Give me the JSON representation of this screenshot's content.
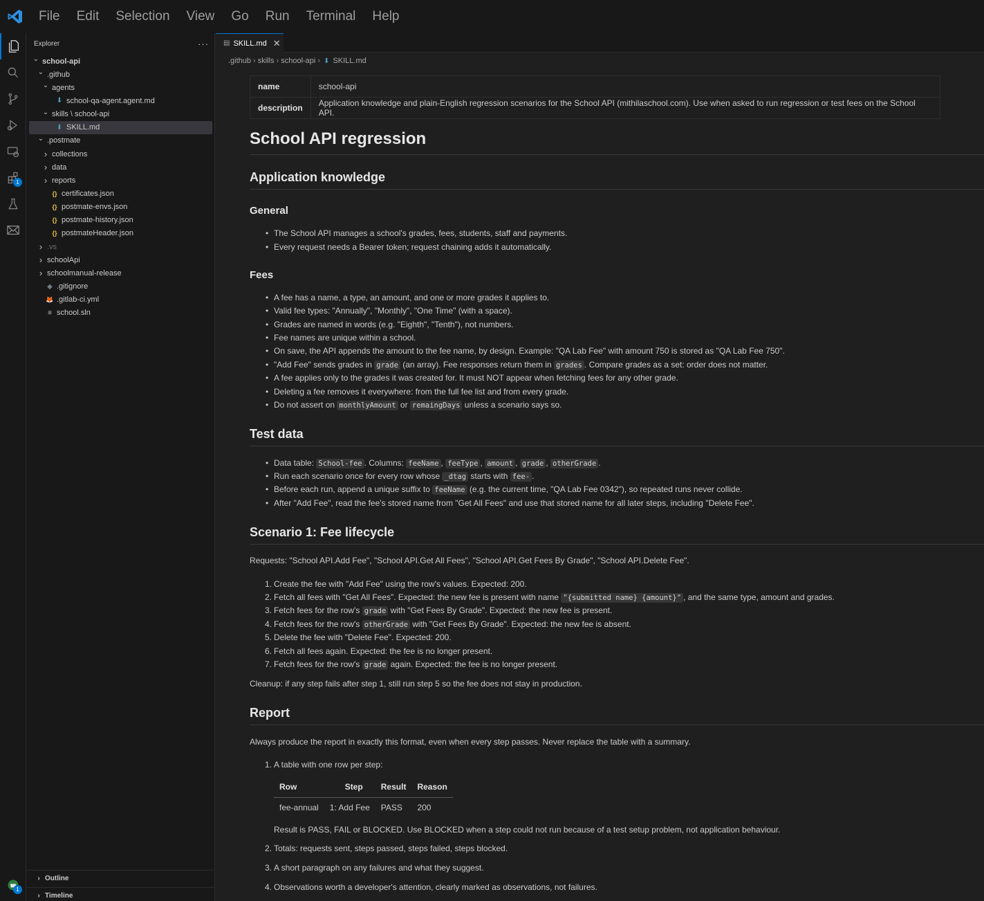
{
  "menu": [
    "File",
    "Edit",
    "Selection",
    "View",
    "Go",
    "Run",
    "Terminal",
    "Help"
  ],
  "activity": {
    "extensions_badge": "1",
    "accounts_badge": "1"
  },
  "explorer": {
    "title": "Explorer",
    "more": "···",
    "tree": [
      {
        "label": "school-api",
        "depth": 0,
        "chev": "open",
        "icon": "",
        "bold": true
      },
      {
        "label": ".github",
        "depth": 1,
        "chev": "open",
        "icon": ""
      },
      {
        "label": "agents",
        "depth": 2,
        "chev": "open",
        "icon": ""
      },
      {
        "label": "school-qa-agent.agent.md",
        "depth": 3,
        "chev": "",
        "icon": "md"
      },
      {
        "label": "skills \\ school-api",
        "depth": 2,
        "chev": "open",
        "icon": ""
      },
      {
        "label": "SKILL.md",
        "depth": 3,
        "chev": "",
        "icon": "md",
        "selected": true
      },
      {
        "label": ".postmate",
        "depth": 1,
        "chev": "open",
        "icon": ""
      },
      {
        "label": "collections",
        "depth": 2,
        "chev": "closed",
        "icon": ""
      },
      {
        "label": "data",
        "depth": 2,
        "chev": "closed",
        "icon": ""
      },
      {
        "label": "reports",
        "depth": 2,
        "chev": "closed",
        "icon": ""
      },
      {
        "label": "certificates.json",
        "depth": 2,
        "chev": "",
        "icon": "json"
      },
      {
        "label": "postmate-envs.json",
        "depth": 2,
        "chev": "",
        "icon": "json"
      },
      {
        "label": "postmate-history.json",
        "depth": 2,
        "chev": "",
        "icon": "json"
      },
      {
        "label": "postmateHeader.json",
        "depth": 2,
        "chev": "",
        "icon": "json"
      },
      {
        "label": ".vs",
        "depth": 1,
        "chev": "closed",
        "icon": "",
        "dim": true
      },
      {
        "label": "schoolApi",
        "depth": 1,
        "chev": "closed",
        "icon": ""
      },
      {
        "label": "schoolmanual-release",
        "depth": 1,
        "chev": "closed",
        "icon": ""
      },
      {
        "label": ".gitignore",
        "depth": 1,
        "chev": "",
        "icon": "git"
      },
      {
        "label": ".gitlab-ci.yml",
        "depth": 1,
        "chev": "",
        "icon": "gitlab"
      },
      {
        "label": "school.sln",
        "depth": 1,
        "chev": "",
        "icon": "sln"
      }
    ],
    "outline": "Outline",
    "timeline": "Timeline"
  },
  "tab": {
    "label": "SKILL.md",
    "close": "✕"
  },
  "breadcrumb": [
    ".github",
    "skills",
    "school-api",
    "SKILL.md"
  ],
  "frontmatter": {
    "name_key": "name",
    "name_val": "school-api",
    "desc_key": "description",
    "desc_val": "Application knowledge and plain-English regression scenarios for the School API (mithilaschool.com). Use when asked to run regression or test fees on the School API."
  },
  "doc": {
    "h1": "School API regression",
    "h2_app": "Application knowledge",
    "h3_general": "General",
    "general": [
      "The School API manages a school's grades, fees, students, staff and payments.",
      "Every request needs a Bearer token; request chaining adds it automatically."
    ],
    "h3_fees": "Fees",
    "fees": {
      "f1": "A fee has a name, a type, an amount, and one or more grades it applies to.",
      "f2": "Valid fee types: \"Annually\", \"Monthly\", \"One Time\" (with a space).",
      "f3": "Grades are named in words (e.g. \"Eighth\", \"Tenth\"), not numbers.",
      "f4": "Fee names are unique within a school.",
      "f5": "On save, the API appends the amount to the fee name, by design. Example: \"QA Lab Fee\" with amount 750 is stored as \"QA Lab Fee 750\".",
      "f6a": "\"Add Fee\" sends grades in ",
      "f6c1": "grade",
      "f6b": " (an array). Fee responses return them in ",
      "f6c2": "grades",
      "f6d": ". Compare grades as a set: order does not matter.",
      "f7": "A fee applies only to the grades it was created for. It must NOT appear when fetching fees for any other grade.",
      "f8": "Deleting a fee removes it everywhere: from the full fee list and from every grade.",
      "f9a": "Do not assert on ",
      "f9c1": "monthlyAmount",
      "f9b": " or ",
      "f9c2": "remaingDays",
      "f9d": " unless a scenario says so."
    },
    "h2_test": "Test data",
    "test": {
      "t1a": "Data table: ",
      "t1c1": "School-fee",
      "t1b": ". Columns: ",
      "t1c2": "feeName",
      "t1c3": "feeType",
      "t1c4": "amount",
      "t1c5": "grade",
      "t1c6": "otherGrade",
      "comma": ", ",
      "period": ".",
      "t2a": "Run each scenario once for every row whose ",
      "t2c1": "_dtag",
      "t2b": " starts with ",
      "t2c2": "fee-",
      "t3a": "Before each run, append a unique suffix to ",
      "t3c": "feeName",
      "t3b": " (e.g. the current time, \"QA Lab Fee 0342\"), so repeated runs never collide.",
      "t4": "After \"Add Fee\", read the fee's stored name from \"Get All Fees\" and use that stored name for all later steps, including \"Delete Fee\"."
    },
    "h2_scn": "Scenario 1: Fee lifecycle",
    "scn_requests": "Requests: \"School API.Add Fee\", \"School API.Get All Fees\", \"School API.Get Fees By Grade\", \"School API.Delete Fee\".",
    "steps": {
      "s1": "Create the fee with \"Add Fee\" using the row's values. Expected: 200.",
      "s2a": "Fetch all fees with \"Get All Fees\". Expected: the new fee is present with name ",
      "s2c": "\"{submitted name} {amount}\"",
      "s2b": ", and the same type, amount and grades.",
      "s3a": "Fetch fees for the row's ",
      "s3c": "grade",
      "s3b": " with \"Get Fees By Grade\". Expected: the new fee is present.",
      "s4a": "Fetch fees for the row's ",
      "s4c": "otherGrade",
      "s4b": " with \"Get Fees By Grade\". Expected: the new fee is absent.",
      "s5": "Delete the fee with \"Delete Fee\". Expected: 200.",
      "s6": "Fetch all fees again. Expected: the fee is no longer present.",
      "s7a": "Fetch fees for the row's ",
      "s7c": "grade",
      "s7b": " again. Expected: the fee is no longer present."
    },
    "cleanup": "Cleanup: if any step fails after step 1, still run step 5 so the fee does not stay in production.",
    "h2_report": "Report",
    "report_intro": "Always produce the report in exactly this format, even when every step passes. Never replace the table with a summary.",
    "r1": "A table with one row per step:",
    "report_table": {
      "headers": [
        "Row",
        "Step",
        "Result",
        "Reason"
      ],
      "row": [
        "fee-annual",
        "1: Add Fee",
        "PASS",
        "200"
      ]
    },
    "r1_note": "Result is PASS, FAIL or BLOCKED. Use BLOCKED when a step could not run because of a test setup problem, not application behaviour.",
    "r2": "Totals: requests sent, steps passed, steps failed, steps blocked.",
    "r3": "A short paragraph on any failures and what they suggest.",
    "r4": "Observations worth a developer's attention, clearly marked as observations, not failures."
  },
  "colors": {
    "accent": "#0078d4",
    "editor_bg": "#1f1f1f",
    "sidebar_bg": "#181818",
    "json": "#e7c547",
    "md": "#519aba"
  }
}
